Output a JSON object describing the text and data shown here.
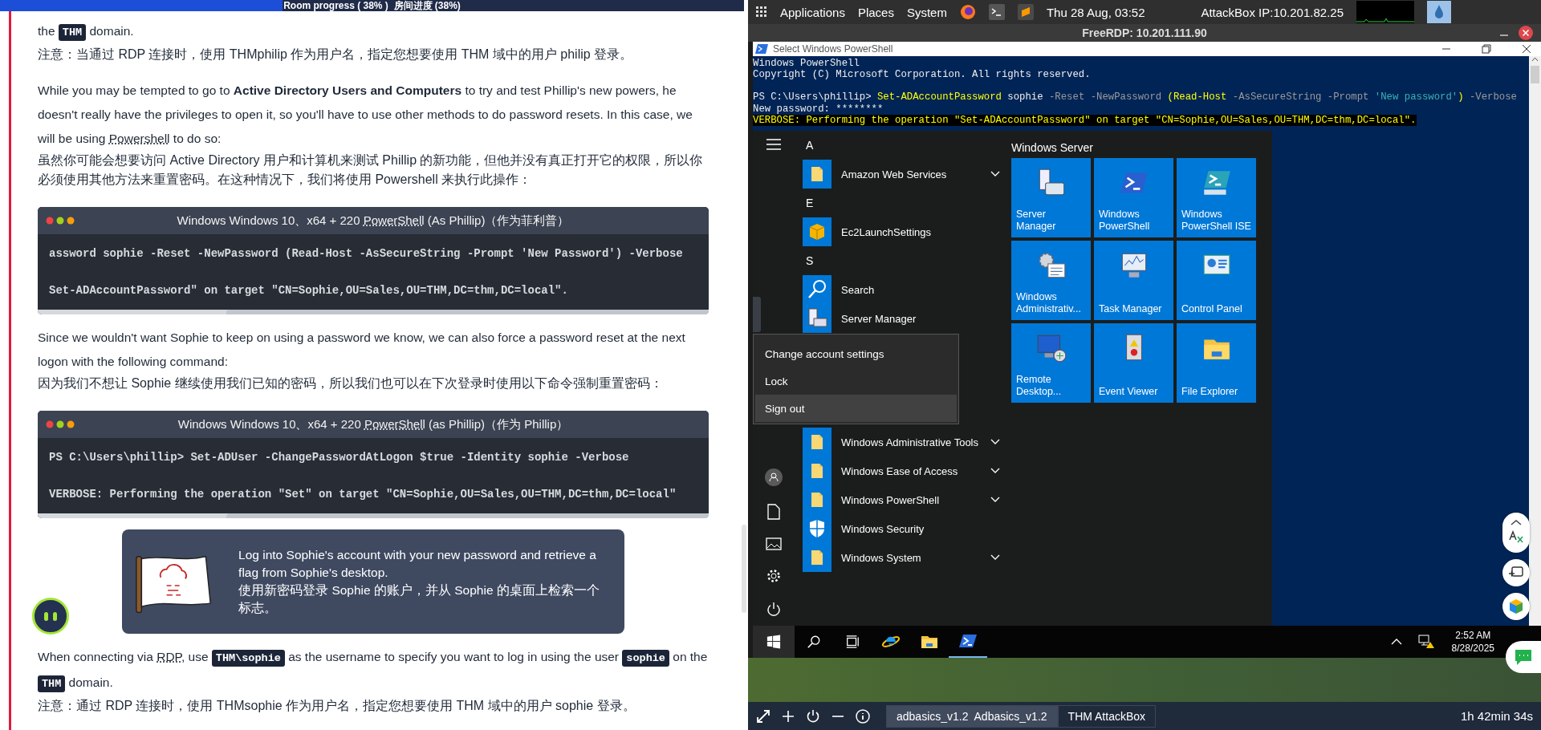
{
  "progress": {
    "label": "Room progress ( 38% )  房间进度 (38%)",
    "level": 0.38
  },
  "article": {
    "blocks": [
      {
        "kind": "para",
        "parts": [
          {
            "kind": "text",
            "text": "the "
          },
          {
            "kind": "code",
            "text": "THM"
          },
          {
            "kind": "text",
            "text": " domain."
          }
        ]
      },
      {
        "kind": "note",
        "text": "注意：当通过 RDP 连接时，使用 THMphilip 作为用户名，指定您想要使用 THM 域中的用户 philip 登录。"
      },
      {
        "kind": "para",
        "parts": [
          {
            "kind": "text",
            "text": "While you may be tempted to go to **Active Directory Users and Computers** to try and test Phillip's new powers, he doesn't really have the privileges to open it, so you'll have to use other methods to do password resets. In this case, we will be using "
          },
          {
            "kind": "abbr",
            "text": "Powershell"
          },
          {
            "kind": "text",
            "text": " to do so:"
          }
        ]
      },
      {
        "kind": "note",
        "text": "虽然你可能会想要访问 Active Directory 用户和计算机来测试 Phillip 的新功能，但他并没有真正打开它的权限，所以你必须使用其他方法来重置密码。在这种情况下，我们将使用 Powershell 来执行此操作："
      },
      {
        "kind": "code",
        "title": [
          {
            "kind": "text",
            "text": "Windows  Windows 10、x64 + 220 "
          },
          {
            "kind": "abbr",
            "text": "PowerShell"
          },
          {
            "kind": "text",
            "text": " (As Phillip)（作为菲利普）"
          }
        ],
        "lines": [
          "assword sophie -Reset -NewPassword (Read-Host -AsSecureString -Prompt 'New Password') -Verbose",
          "Set-ADAccountPassword\" on target \"CN=Sophie,OU=Sales,OU=THM,DC=thm,DC=local\"."
        ]
      },
      {
        "kind": "para",
        "parts": [
          {
            "kind": "text",
            "text": "Since we wouldn't want Sophie to keep on using a password we know, we can also force a password reset at the next logon with the following command:"
          }
        ]
      },
      {
        "kind": "note",
        "text": "因为我们不想让 Sophie 继续使用我们已知的密码，所以我们也可以在下次登录时使用以下命令强制重置密码："
      },
      {
        "kind": "code",
        "title": [
          {
            "kind": "text",
            "text": "Windows  Windows 10、x64 + 220 "
          },
          {
            "kind": "abbr",
            "text": "PowerShell"
          },
          {
            "kind": "text",
            "text": " (as Phillip)（作为 Phillip）"
          }
        ],
        "lines": [
          "PS C:\\Users\\phillip> Set-ADUser -ChangePasswordAtLogon $true -Identity sophie -Verbose",
          "VERBOSE: Performing the operation \"Set\" on target \"CN=Sophie,OU=Sales,OU=THM,DC=thm,DC=local\""
        ]
      },
      {
        "kind": "callout",
        "text": "Log into Sophie's account with your new password and retrieve a flag from Sophie's desktop.",
        "translation": "使用新密码登录 Sophie 的账户，并从 Sophie 的桌面上检索一个标志。"
      },
      {
        "kind": "para",
        "parts": [
          {
            "kind": "text",
            "text": "When connecting via "
          },
          {
            "kind": "abbr",
            "text": "RDP"
          },
          {
            "kind": "text",
            "text": ", use "
          },
          {
            "kind": "code",
            "text": "THM\\sophie"
          },
          {
            "kind": "text",
            "text": " as the username to specify you want to log in using the user "
          },
          {
            "kind": "code",
            "text": "sophie"
          },
          {
            "kind": "text",
            "text": " on the "
          },
          {
            "kind": "code",
            "text": "THM"
          },
          {
            "kind": "text",
            "text": " domain."
          }
        ]
      },
      {
        "kind": "note",
        "text": "注意：通过 RDP 连接时，使用 THMsophie 作为用户名，指定您想要使用 THM 域中的用户 sophie 登录。"
      }
    ]
  },
  "top_panel": {
    "menus": [
      "Applications",
      "Places",
      "System"
    ],
    "clock": "Thu 28 Aug, 03:52",
    "ip": "AttackBox IP:10.201.82.25"
  },
  "rdp_window": {
    "title": "FreeRDP: 10.201.111.90"
  },
  "powershell": {
    "title": "Select Windows PowerShell",
    "lines": [
      {
        "kind": "plain",
        "tokens": [
          {
            "kind": "out",
            "text": "Windows PowerShell"
          }
        ]
      },
      {
        "kind": "plain",
        "tokens": [
          {
            "kind": "out",
            "text": "Copyright (C) Microsoft Corporation. All rights reserved."
          }
        ]
      },
      {
        "kind": "command",
        "tokens": [
          {
            "kind": "out",
            "text": "PS C:\\Users\\phillip> "
          },
          {
            "kind": "cmd",
            "text": "Set-ADAccountPassword"
          },
          {
            "kind": "out",
            "text": " sophie "
          },
          {
            "kind": "param",
            "text": "-Reset -NewPassword "
          },
          {
            "kind": "cmd",
            "text": "(Read-Host"
          },
          {
            "kind": "param",
            "text": " -AsSecureString -Prompt "
          },
          {
            "kind": "str",
            "text": "'New password'"
          },
          {
            "kind": "cmd",
            "text": ")"
          },
          {
            "kind": "param",
            "text": " -Verbose"
          }
        ]
      },
      {
        "kind": "plain",
        "tokens": [
          {
            "kind": "out",
            "text": "New password: ********"
          }
        ]
      },
      {
        "kind": "verbose",
        "tokens": [
          {
            "kind": "out",
            "text": "VERBOSE: Performing the operation \"Set-ADAccountPassword\" on target \"CN=Sophie,OU=Sales,OU=THM,DC=thm,DC=local\"."
          }
        ]
      }
    ]
  },
  "start_menu": {
    "sections": [
      {
        "letter": "A",
        "apps": [
          {
            "name": "Amazon Web Services",
            "kind": "folder",
            "expandable": true
          }
        ]
      },
      {
        "letter": "E",
        "apps": [
          {
            "name": "Ec2LaunchSettings",
            "kind": "box",
            "expandable": false
          }
        ]
      },
      {
        "letter": "S",
        "apps": [
          {
            "name": "Search",
            "kind": "search",
            "expandable": false
          },
          {
            "name": "Server Manager",
            "kind": "server",
            "expandable": false
          }
        ]
      },
      {
        "apps": [
          {
            "name": "Windows Administrative Tools",
            "kind": "folder",
            "expandable": true
          },
          {
            "name": "Windows Ease of Access",
            "kind": "folder",
            "expandable": true
          },
          {
            "name": "Windows PowerShell",
            "kind": "folder",
            "expandable": true
          },
          {
            "name": "Windows Security",
            "kind": "shield",
            "expandable": false
          },
          {
            "name": "Windows System",
            "kind": "folder",
            "expandable": true
          }
        ]
      }
    ],
    "tiles_header": "Windows Server",
    "tiles": [
      {
        "label": "Server Manager",
        "kind": "server"
      },
      {
        "label": "Windows PowerShell",
        "kind": "powershell"
      },
      {
        "label": "Windows PowerShell ISE",
        "kind": "ise"
      },
      {
        "label": "Windows Administrativ...",
        "kind": "admin"
      },
      {
        "label": "Task Manager",
        "kind": "taskmgr"
      },
      {
        "label": "Control Panel",
        "kind": "control"
      },
      {
        "label": "Remote Desktop...",
        "kind": "remote"
      },
      {
        "label": "Event Viewer",
        "kind": "events"
      },
      {
        "label": "File Explorer",
        "kind": "explorer"
      }
    ],
    "account_menu": [
      {
        "label": "Change account settings",
        "selected": false
      },
      {
        "label": "Lock",
        "selected": false
      },
      {
        "label": "Sign out",
        "selected": true
      }
    ]
  },
  "taskbar": {
    "items": [
      {
        "kind": "start",
        "active": false
      },
      {
        "kind": "search",
        "active": false
      },
      {
        "kind": "taskview",
        "active": false
      },
      {
        "kind": "browser",
        "active": false
      },
      {
        "kind": "explorer",
        "active": false
      },
      {
        "kind": "powershell",
        "active": true
      }
    ],
    "time": "2:52 AM",
    "date": "8/28/2025"
  },
  "session_bar": {
    "tabs": [
      {
        "label": "adbasics_v1.2  Adbasics_v1.2",
        "selected": true
      },
      {
        "label": "THM AttackBox",
        "selected": false
      }
    ],
    "timer": "1h 42min 34s"
  }
}
